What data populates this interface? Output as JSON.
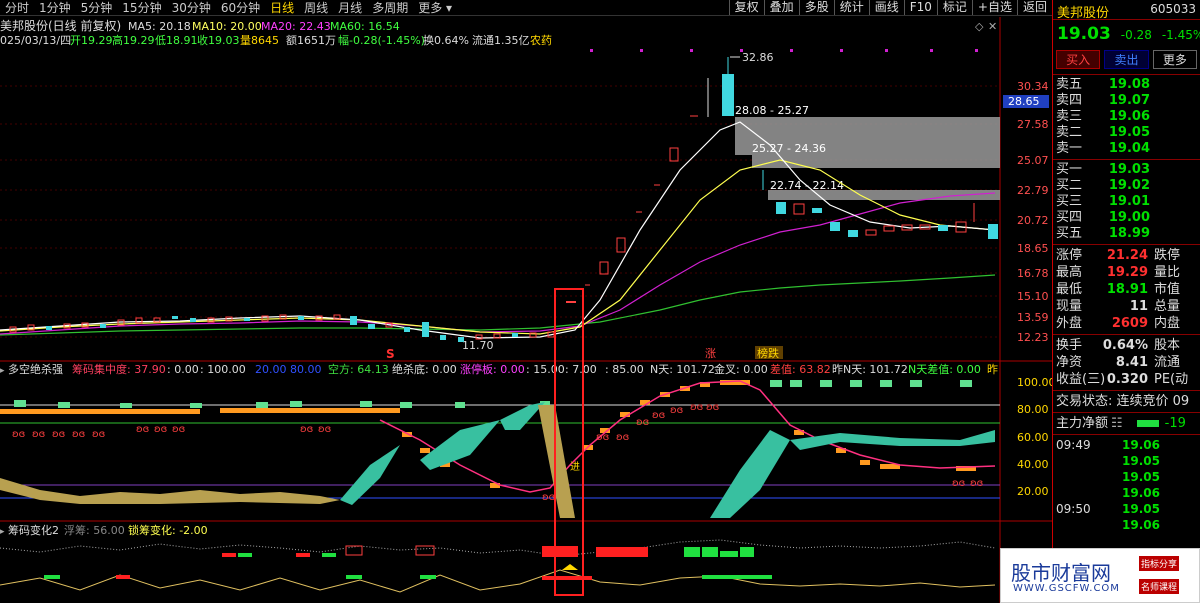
{
  "toolbar": {
    "tabs": [
      "分时",
      "1分钟",
      "5分钟",
      "15分钟",
      "30分钟",
      "60分钟",
      "日线",
      "周线",
      "月线",
      "多周期",
      "更多"
    ],
    "active_tab": "日线",
    "buttons": [
      "复权",
      "叠加",
      "多股",
      "统计",
      "画线",
      "F10",
      "标记",
      "+自选",
      "返回"
    ]
  },
  "chart_header": {
    "title": "美邦股份(日线 前复权)",
    "ma5": "MA5: 20.18",
    "ma10": "MA10: 20.00",
    "ma20": "MA20: 22.43",
    "ma60": "MA60: 16.54",
    "info_date": "025/03/13/四",
    "info_open": "开19.29",
    "info_high": "高19.29",
    "info_low": "低18.91",
    "info_close": "收19.03",
    "info_vol": "量8645",
    "info_amount": "额1651万",
    "info_change": "幅-0.28(-1.45%)",
    "info_turnover": "换0.64%",
    "info_float": "流通1.35亿",
    "info_sector": "农药"
  },
  "price_axis": [
    "30.34",
    "27.58",
    "25.07",
    "22.79",
    "20.72",
    "18.65",
    "16.78",
    "15.10",
    "13.59",
    "12.23"
  ],
  "price_tag": "28.65",
  "annotations": {
    "high": "32.86",
    "low": "11.70",
    "chip1": "28.08 - 25.27",
    "chip2": "25.27 - 24.36",
    "chip3": "22.74 - 22.14",
    "mark_s": "S",
    "mark_zhang": "涨",
    "mark_bang": "榜跌",
    "jin": "进"
  },
  "indicator1": {
    "name": "多空绝杀强",
    "f1": "筹码集中度: 37.90",
    "f2": ": 0.00",
    "f3": ": 100.00",
    "f4": "20.00",
    "f5": "80.00",
    "f6": "空方: 64.13",
    "f7": "绝杀底: 0.00",
    "f8": "涨停板: 0.00",
    "f9": ": 15.00",
    "f10": ": 7.00",
    "f11": ": 85.00",
    "f12": "N天: 101.72",
    "f13": "金叉: 0.00",
    "f14": "差值: 63.82",
    "f15": "昨N天: 101.72",
    "f16": "N天差值: 0.00",
    "f17": "昨",
    "axis": [
      "100.00",
      "80.00",
      "60.00",
      "40.00",
      "20.00"
    ]
  },
  "indicator2": {
    "name": "筹码变化2",
    "f1": "浮筹: 56.00",
    "f2": "锁筹变化: -2.00"
  },
  "side": {
    "name": "美邦股份",
    "code": "605033",
    "price": "19.03",
    "change": "-0.28",
    "pct": "-1.45%",
    "btn_buy": "买入",
    "btn_sell": "卖出",
    "btn_more": "更多",
    "sell_orders": [
      {
        "label": "卖五",
        "price": "19.08"
      },
      {
        "label": "卖四",
        "price": "19.07"
      },
      {
        "label": "卖三",
        "price": "19.06"
      },
      {
        "label": "卖二",
        "price": "19.05"
      },
      {
        "label": "卖一",
        "price": "19.04"
      }
    ],
    "buy_orders": [
      {
        "label": "买一",
        "price": "19.03"
      },
      {
        "label": "买二",
        "price": "19.02"
      },
      {
        "label": "买三",
        "price": "19.01"
      },
      {
        "label": "买四",
        "price": "19.00"
      },
      {
        "label": "买五",
        "price": "18.99"
      }
    ],
    "stats": [
      {
        "label": "涨停",
        "value": "21.24",
        "label2": "跌停",
        "color": "red"
      },
      {
        "label": "最高",
        "value": "19.29",
        "label2": "量比",
        "color": "red"
      },
      {
        "label": "最低",
        "value": "18.91",
        "label2": "市值",
        "color": "grn"
      },
      {
        "label": "现量",
        "value": "11",
        "label2": "总量",
        "color": "wht"
      },
      {
        "label": "外盘",
        "value": "2609",
        "label2": "内盘",
        "color": "red"
      }
    ],
    "stats2": [
      {
        "label": "换手",
        "value": "0.64%",
        "label2": "股本",
        "color": "wht"
      },
      {
        "label": "净资",
        "value": "8.41",
        "label2": "流通",
        "color": "wht"
      },
      {
        "label": "收益(三)",
        "value": "0.320",
        "label2": "PE(动",
        "color": "wht"
      }
    ],
    "trade_status": "交易状态: 连续竞价 09",
    "main_flow": "主力净额",
    "main_flow_val": "-19",
    "ticks": [
      {
        "time": "09:49",
        "price": "19.06"
      },
      {
        "time": "",
        "price": "19.05"
      },
      {
        "time": "",
        "price": "19.05"
      },
      {
        "time": "",
        "price": "19.06"
      },
      {
        "time": "09:50",
        "price": "19.05"
      },
      {
        "time": "",
        "price": "19.06"
      }
    ]
  },
  "watermark": {
    "main": "股市财富网",
    "url": "WWW.GSCFW.COM",
    "badge1": "指标分享",
    "badge2": "名师课程"
  }
}
